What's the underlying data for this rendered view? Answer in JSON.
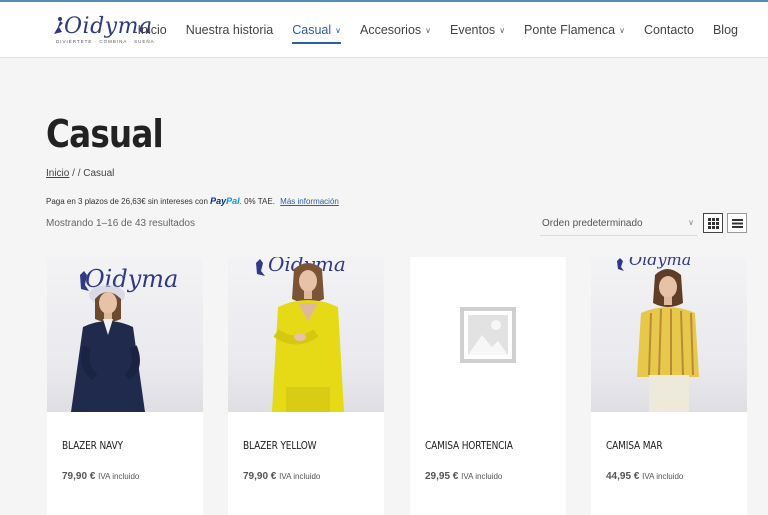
{
  "header": {
    "logo": {
      "name": "Oidyma",
      "tagline": "DIVIÉRTETE · COMBINA · SUEÑA"
    },
    "nav": [
      {
        "label": "Inicio",
        "has_dropdown": false,
        "active": false
      },
      {
        "label": "Nuestra historia",
        "has_dropdown": false,
        "active": false
      },
      {
        "label": "Casual",
        "has_dropdown": true,
        "active": true
      },
      {
        "label": "Accesorios",
        "has_dropdown": true,
        "active": false
      },
      {
        "label": "Eventos",
        "has_dropdown": true,
        "active": false
      },
      {
        "label": "Ponte Flamenca",
        "has_dropdown": true,
        "active": false
      },
      {
        "label": "Contacto",
        "has_dropdown": false,
        "active": false
      },
      {
        "label": "Blog",
        "has_dropdown": false,
        "active": false
      }
    ]
  },
  "page": {
    "title": "Casual",
    "breadcrumb": {
      "home": "Inicio",
      "separator": " / / ",
      "current": "Casual"
    },
    "paypal": {
      "text": "Paga en 3 plazos de 26,63€ sin intereses con",
      "brand_a": "Pay",
      "brand_b": "Pal",
      "suffix": ". 0% TAE.",
      "link": "Más información"
    },
    "results": "Mostrando 1–16 de 43 resultados",
    "sort": {
      "selected": "Orden predeterminado"
    }
  },
  "products": [
    {
      "name": "BLAZER NAVY",
      "price": "79,90 €",
      "tax": "IVA incluido",
      "image": "photo"
    },
    {
      "name": "BLAZER YELLOW",
      "price": "79,90 €",
      "tax": "IVA incluido",
      "image": "photo"
    },
    {
      "name": "CAMISA HORTENCIA",
      "price": "29,95 €",
      "tax": "IVA incluido",
      "image": "placeholder"
    },
    {
      "name": "CAMISA MAR",
      "price": "44,95 €",
      "tax": "IVA incluido",
      "image": "photo"
    }
  ],
  "colors": {
    "accent": "#2b5ea3",
    "brand": "#2e3a7c",
    "background": "#f5f5f5"
  },
  "icons": [
    "dancer-logo-icon",
    "chevron-down-icon",
    "grid-view-icon",
    "list-view-icon",
    "image-placeholder-icon"
  ]
}
